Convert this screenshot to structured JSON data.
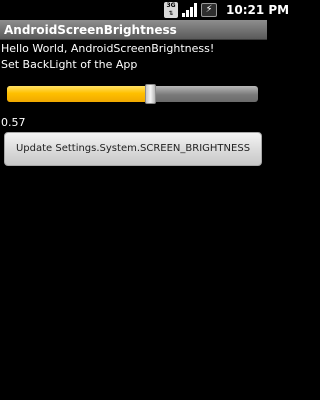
{
  "status_bar": {
    "network_label": "3G",
    "time": "10:21 PM",
    "icons": [
      "3g-data-icon",
      "signal-strength-icon",
      "battery-charging-icon"
    ]
  },
  "app": {
    "title": "AndroidScreenBrightness"
  },
  "content": {
    "greeting": "Hello World, AndroidScreenBrightness!",
    "instruction": "Set BackLight of the App",
    "brightness_value": "0.57",
    "brightness_fraction": 0.57,
    "button_label": "Update Settings.System.SCREEN_BRIGHTNESS"
  },
  "colors": {
    "seek_fill": "#ffc000",
    "title_bar": "#7a7a7a",
    "background": "#000000"
  }
}
